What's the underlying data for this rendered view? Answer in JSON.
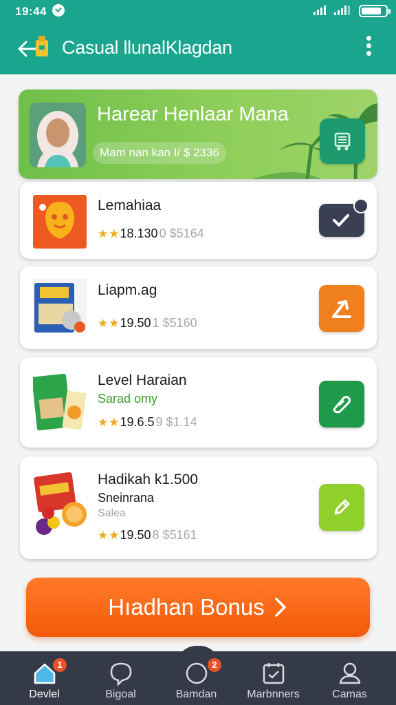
{
  "status_bar": {
    "time": "19:44"
  },
  "header": {
    "title": "Casual llunalKlagdan"
  },
  "banner": {
    "title": "Harear Henlaar Mana",
    "pill_text": "Mam nan kan  I/  $ 2336"
  },
  "items": [
    {
      "title": "Lemahiaa",
      "subtitle": "",
      "subtitle2": "",
      "rating": "18.130",
      "rating_muted": "0 $5164",
      "action_icon": "check-icon",
      "action_color": "#3a3f52"
    },
    {
      "title": "Liapm.ag",
      "subtitle": "",
      "subtitle2": "",
      "rating": "19.50",
      "rating_muted": "1 $5160",
      "action_icon": "share-arrow-icon",
      "action_color": "#f0801e"
    },
    {
      "title": "Level Haraian",
      "subtitle": "Sarad omy",
      "subtitle2": "",
      "rating": "19.6.5",
      "rating_muted": "9 $1.14",
      "action_icon": "tag-icon",
      "action_color": "#1f9a4a"
    },
    {
      "title": "Hadikah k1.500",
      "subtitle": "Sneinrana",
      "subtitle2": "Salea",
      "rating": "19.50",
      "rating_muted": "8 $5161",
      "action_icon": "pencil-icon",
      "action_color": "#8fd12a"
    }
  ],
  "cta": {
    "label": "Hıadhan Bonus"
  },
  "nav": [
    {
      "label": "Devlel",
      "icon": "home-icon",
      "badge": "1"
    },
    {
      "label": "Bigoal",
      "icon": "chat-icon",
      "badge": ""
    },
    {
      "label": "Bamdan",
      "icon": "search-icon",
      "badge": "2"
    },
    {
      "label": "Marbnners",
      "icon": "calendar-icon",
      "badge": ""
    },
    {
      "label": "Camas",
      "icon": "profile-icon",
      "badge": ""
    }
  ]
}
